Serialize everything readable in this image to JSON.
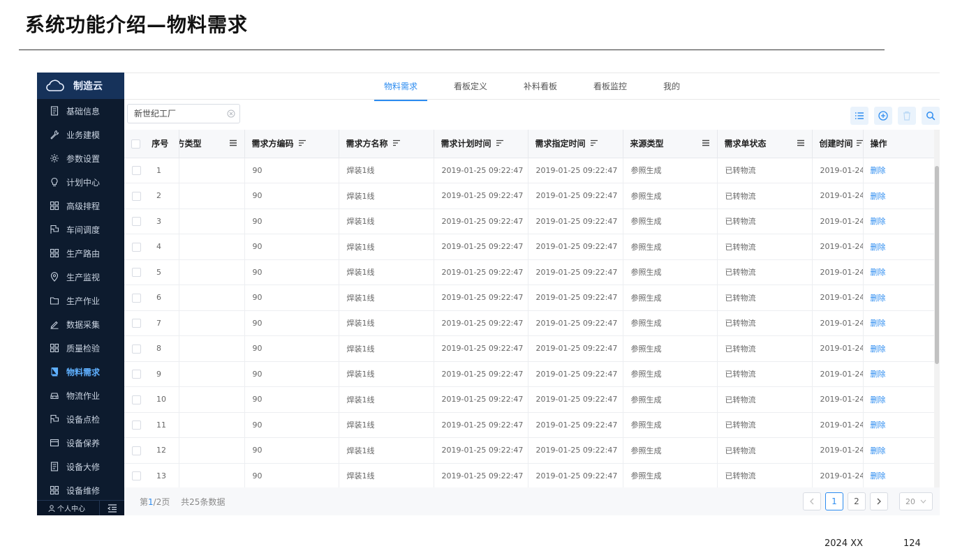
{
  "slide": {
    "title": "系统功能介绍—物料需求",
    "date": "2024 XX",
    "page_number": "124"
  },
  "sidebar": {
    "brand": "制造云",
    "items": [
      {
        "label": "基础信息",
        "icon": "document-icon",
        "active": false
      },
      {
        "label": "业务建模",
        "icon": "wrench-icon",
        "active": false
      },
      {
        "label": "参数设置",
        "icon": "gear-icon",
        "active": false
      },
      {
        "label": "计划中心",
        "icon": "lightbulb-icon",
        "active": false
      },
      {
        "label": "高级排程",
        "icon": "grid-icon",
        "active": false
      },
      {
        "label": "车间调度",
        "icon": "flag-icon",
        "active": false
      },
      {
        "label": "生产路由",
        "icon": "grid-icon",
        "active": false
      },
      {
        "label": "生产监视",
        "icon": "location-pin-icon",
        "active": false
      },
      {
        "label": "生产作业",
        "icon": "folder-icon",
        "active": false
      },
      {
        "label": "数据采集",
        "icon": "pen-icon",
        "active": false
      },
      {
        "label": "质量检验",
        "icon": "grid-icon",
        "active": false
      },
      {
        "label": "物料需求",
        "icon": "book-icon",
        "active": true
      },
      {
        "label": "物流作业",
        "icon": "car-icon",
        "active": false
      },
      {
        "label": "设备点检",
        "icon": "flag-icon",
        "active": false
      },
      {
        "label": "设备保养",
        "icon": "card-icon",
        "active": false
      },
      {
        "label": "设备大修",
        "icon": "document-icon",
        "active": false
      },
      {
        "label": "设备维修",
        "icon": "grid-icon",
        "active": false
      }
    ],
    "profile_label": "个人中心"
  },
  "tabs": [
    {
      "label": "物料需求",
      "active": true
    },
    {
      "label": "看板定义",
      "active": false
    },
    {
      "label": "补料看板",
      "active": false
    },
    {
      "label": "看板监控",
      "active": false
    },
    {
      "label": "我的",
      "active": false
    }
  ],
  "search": {
    "value": "新世纪工厂"
  },
  "table": {
    "headers": {
      "index": "序号",
      "type": "方类型",
      "code": "需求方编码",
      "name": "需求方名称",
      "plan_time": "需求计划时间",
      "spec_time": "需求指定时间",
      "source": "来源类型",
      "status": "需求单状态",
      "created": "创建时间",
      "op": "操作"
    },
    "rows": [
      {
        "index": "1",
        "type": "",
        "code": "90",
        "name": "焊装1线",
        "plan_time": "2019-01-25 09:22:47",
        "spec_time": "2019-01-25 09:22:47",
        "source": "参照生成",
        "status": "已转物流",
        "created": "2019-01-24",
        "op": "删除"
      },
      {
        "index": "2",
        "type": "",
        "code": "90",
        "name": "焊装1线",
        "plan_time": "2019-01-25 09:22:47",
        "spec_time": "2019-01-25 09:22:47",
        "source": "参照生成",
        "status": "已转物流",
        "created": "2019-01-24",
        "op": "删除"
      },
      {
        "index": "3",
        "type": "",
        "code": "90",
        "name": "焊装1线",
        "plan_time": "2019-01-25 09:22:47",
        "spec_time": "2019-01-25 09:22:47",
        "source": "参照生成",
        "status": "已转物流",
        "created": "2019-01-24",
        "op": "删除"
      },
      {
        "index": "4",
        "type": "",
        "code": "90",
        "name": "焊装1线",
        "plan_time": "2019-01-25 09:22:47",
        "spec_time": "2019-01-25 09:22:47",
        "source": "参照生成",
        "status": "已转物流",
        "created": "2019-01-24",
        "op": "删除"
      },
      {
        "index": "5",
        "type": "",
        "code": "90",
        "name": "焊装1线",
        "plan_time": "2019-01-25 09:22:47",
        "spec_time": "2019-01-25 09:22:47",
        "source": "参照生成",
        "status": "已转物流",
        "created": "2019-01-24",
        "op": "删除"
      },
      {
        "index": "6",
        "type": "",
        "code": "90",
        "name": "焊装1线",
        "plan_time": "2019-01-25 09:22:47",
        "spec_time": "2019-01-25 09:22:47",
        "source": "参照生成",
        "status": "已转物流",
        "created": "2019-01-24",
        "op": "删除"
      },
      {
        "index": "7",
        "type": "",
        "code": "90",
        "name": "焊装1线",
        "plan_time": "2019-01-25 09:22:47",
        "spec_time": "2019-01-25 09:22:47",
        "source": "参照生成",
        "status": "已转物流",
        "created": "2019-01-24",
        "op": "删除"
      },
      {
        "index": "8",
        "type": "",
        "code": "90",
        "name": "焊装1线",
        "plan_time": "2019-01-25 09:22:47",
        "spec_time": "2019-01-25 09:22:47",
        "source": "参照生成",
        "status": "已转物流",
        "created": "2019-01-24",
        "op": "删除"
      },
      {
        "index": "9",
        "type": "",
        "code": "90",
        "name": "焊装1线",
        "plan_time": "2019-01-25 09:22:47",
        "spec_time": "2019-01-25 09:22:47",
        "source": "参照生成",
        "status": "已转物流",
        "created": "2019-01-24",
        "op": "删除"
      },
      {
        "index": "10",
        "type": "",
        "code": "90",
        "name": "焊装1线",
        "plan_time": "2019-01-25 09:22:47",
        "spec_time": "2019-01-25 09:22:47",
        "source": "参照生成",
        "status": "已转物流",
        "created": "2019-01-24",
        "op": "删除"
      },
      {
        "index": "11",
        "type": "",
        "code": "90",
        "name": "焊装1线",
        "plan_time": "2019-01-25 09:22:47",
        "spec_time": "2019-01-25 09:22:47",
        "source": "参照生成",
        "status": "已转物流",
        "created": "2019-01-24",
        "op": "删除"
      },
      {
        "index": "12",
        "type": "",
        "code": "90",
        "name": "焊装1线",
        "plan_time": "2019-01-25 09:22:47",
        "spec_time": "2019-01-25 09:22:47",
        "source": "参照生成",
        "status": "已转物流",
        "created": "2019-01-24",
        "op": "删除"
      },
      {
        "index": "13",
        "type": "",
        "code": "90",
        "name": "焊装1线",
        "plan_time": "2019-01-25 09:22:47",
        "spec_time": "2019-01-25 09:22:47",
        "source": "参照生成",
        "status": "已转物流",
        "created": "2019-01-24",
        "op": "删除"
      }
    ]
  },
  "pagination": {
    "page_prefix": "第",
    "current": "1",
    "page_suffix": "/2页",
    "total_text": "共25条数据",
    "pages": [
      "1",
      "2"
    ],
    "page_size": "20"
  },
  "colors": {
    "accent": "#2d8cf0",
    "sidebar_bg": "#0d1b2e",
    "sidebar_active": "#5fb0ff"
  }
}
